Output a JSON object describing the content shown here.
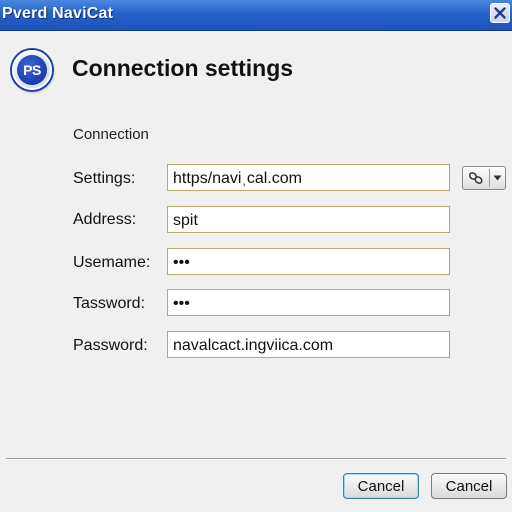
{
  "window": {
    "title": "Pverd NaviCat",
    "close_icon": "close-icon"
  },
  "app_icon": {
    "text": "PS",
    "color": "#1c3ba8"
  },
  "heading": "Connection settings",
  "section_label": "Connection",
  "fields": [
    {
      "label": "Settings:",
      "value": "https/naviˌcal.com"
    },
    {
      "label": "Address:",
      "value": "spit"
    },
    {
      "label": "Usemame:",
      "value": "•••"
    },
    {
      "label": "Tassword:",
      "value": "•••"
    },
    {
      "label": "Password:",
      "value": "navalcact.ingviica.com"
    }
  ],
  "picker": {
    "icon": "link-icon",
    "caret": "chevron-down-icon"
  },
  "buttons": {
    "primary_label": "Cancel",
    "secondary_label": "Cancel"
  },
  "colors": {
    "titlebar": "#2661c9",
    "field_border": "#b7a873",
    "primary_button_border": "#3c7fb1"
  }
}
